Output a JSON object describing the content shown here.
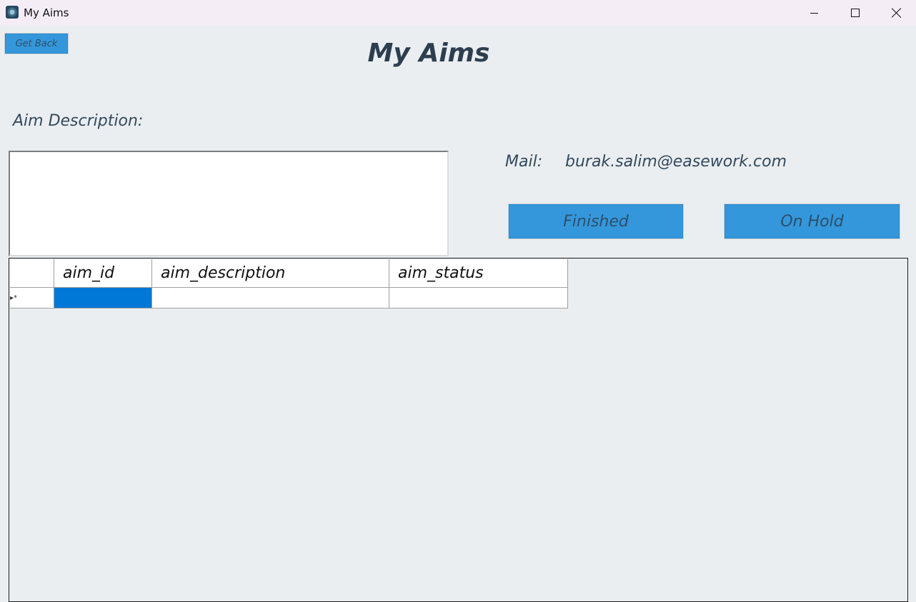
{
  "window": {
    "title": "My Aims",
    "controls": [
      "minimize-icon",
      "maximize-icon",
      "close-icon"
    ]
  },
  "toolbar": {
    "get_back_label": "Get Back"
  },
  "page": {
    "title": "My Aims"
  },
  "form": {
    "aim_description_label": "Aim Description:",
    "aim_description_value": "",
    "mail_label": "Mail:",
    "mail_value": "burak.salim@easework.com",
    "finished_label": "Finished",
    "on_hold_label": "On Hold"
  },
  "grid": {
    "columns": [
      "aim_id",
      "aim_description",
      "aim_status"
    ],
    "new_row_indicator": "▸*",
    "rows": [
      {
        "aim_id": "",
        "aim_description": "",
        "aim_status": ""
      }
    ]
  },
  "colors": {
    "accent": "#3497db",
    "background": "#eaeef0",
    "text": "#34495e",
    "selection": "#0078d7"
  }
}
